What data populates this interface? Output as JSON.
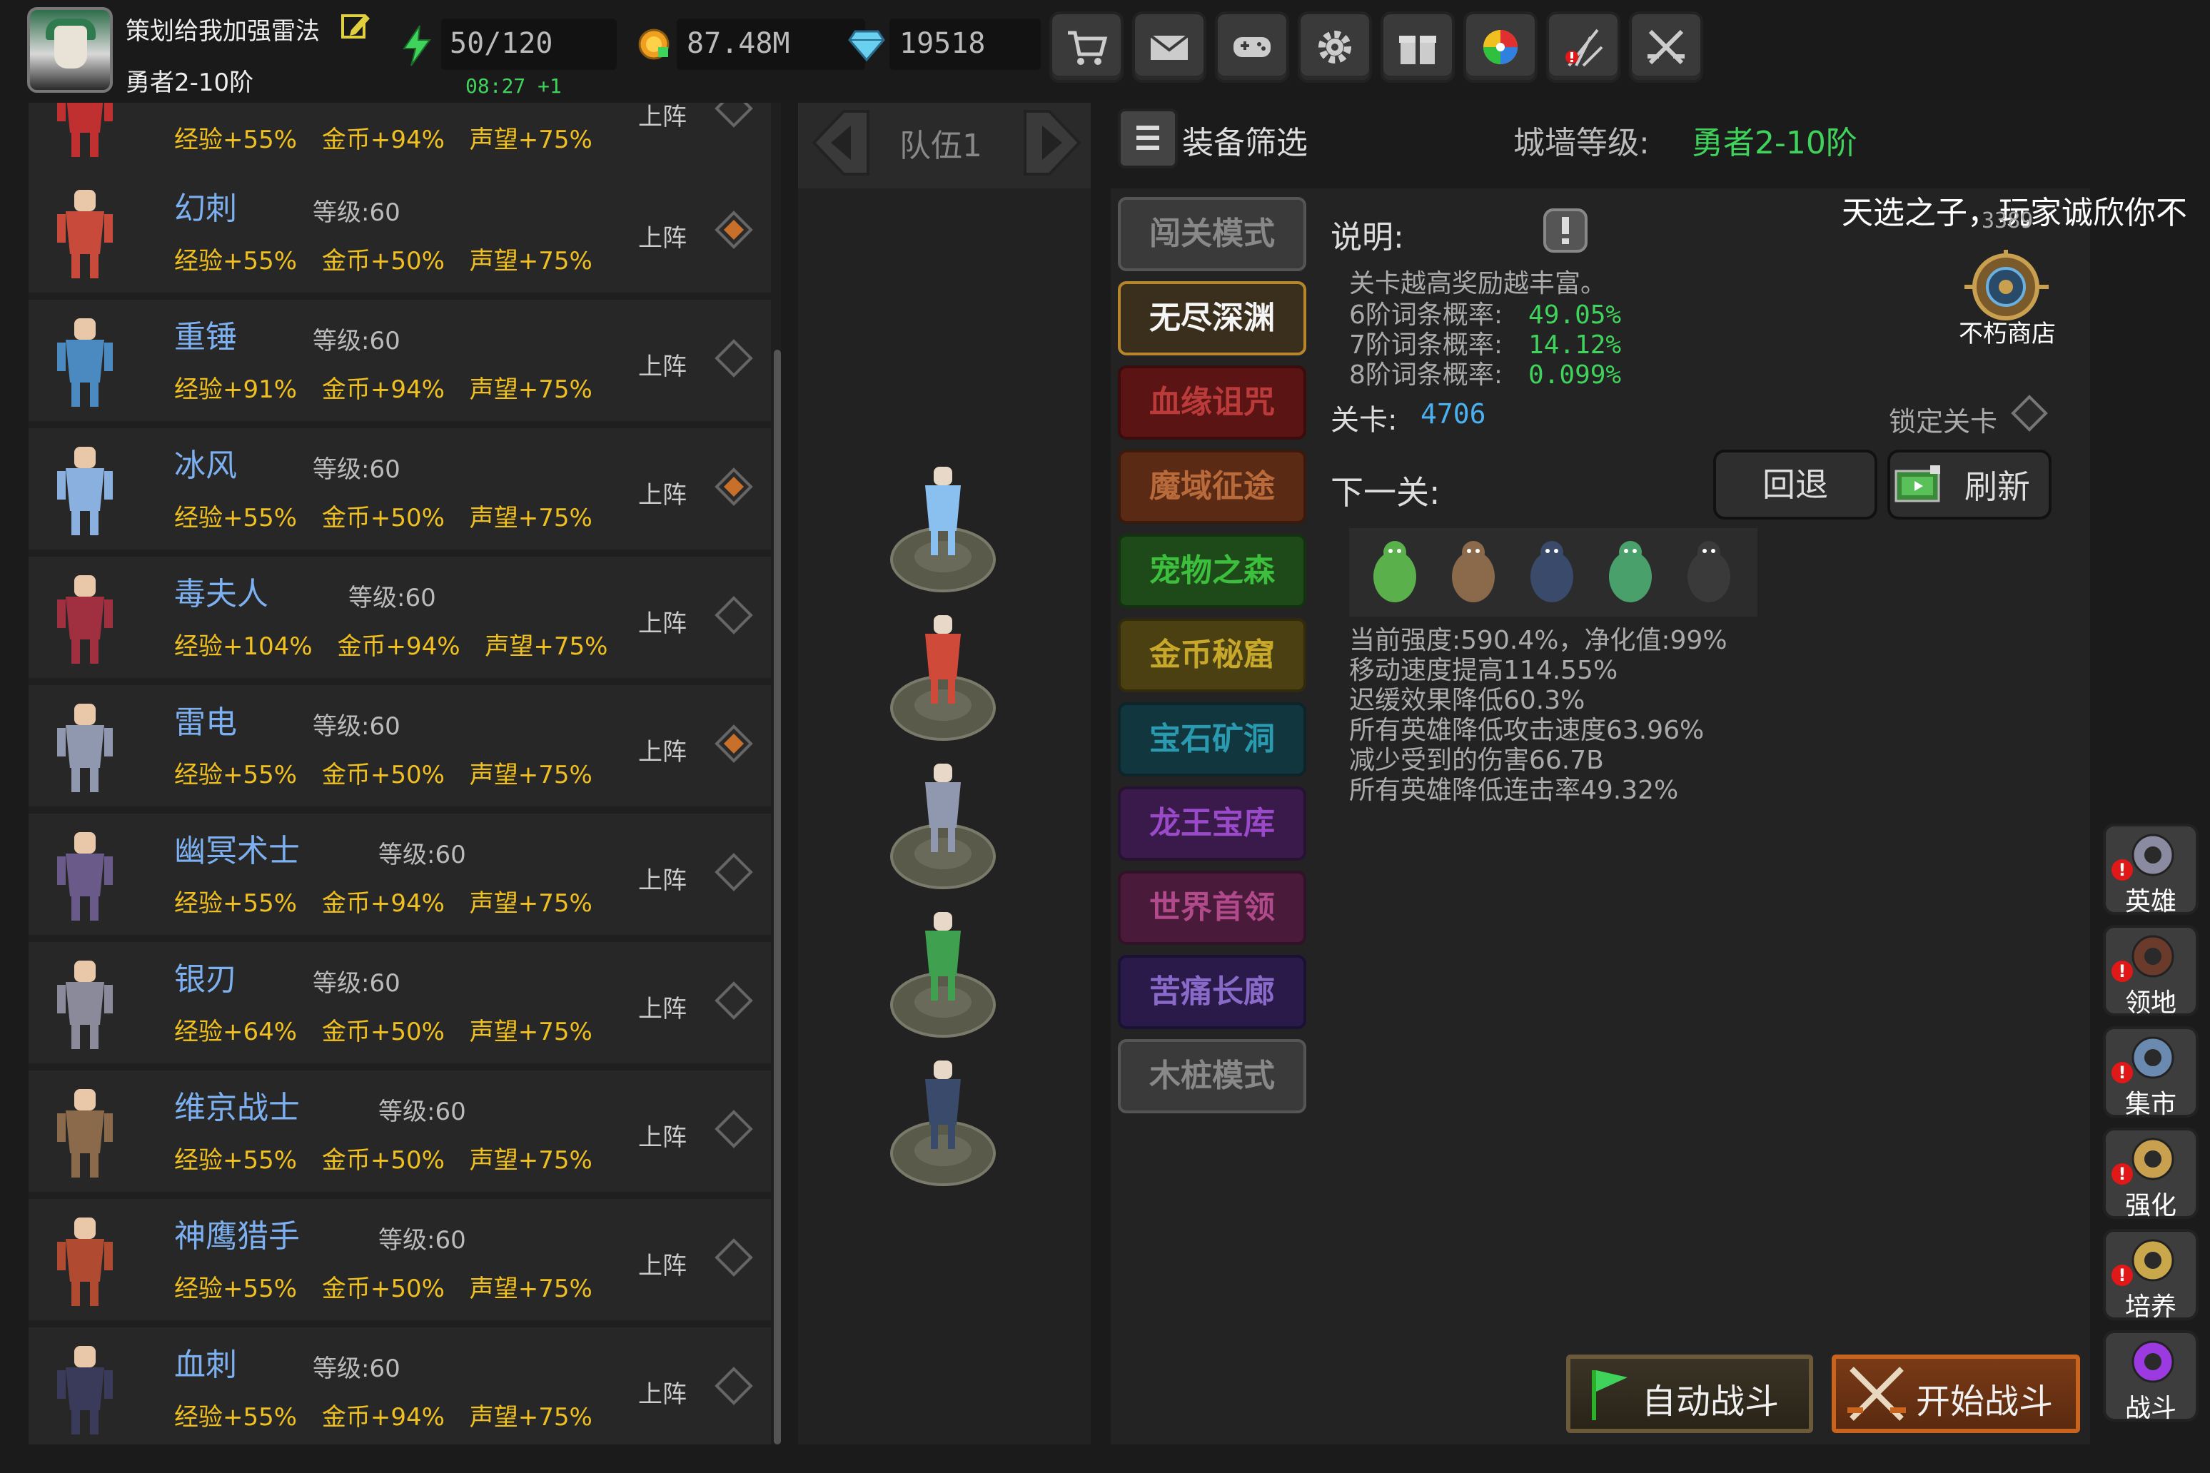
{
  "player": {
    "name": "策划给我加强雷法",
    "rank": "勇者2-10阶"
  },
  "resources": {
    "energy": "50/120",
    "energy_timer": "08:27 +1",
    "gold": "87.48M",
    "gems": "19518"
  },
  "top_buttons": [
    "shop-cart-icon",
    "mail-icon",
    "gamepad-icon",
    "settings-gear-icon",
    "gift-icon",
    "color-wheel-icon",
    "fireworks-icon",
    "crossed-swords-icon"
  ],
  "heroes": [
    {
      "name": "",
      "level": "",
      "exp": "经验+55%",
      "gold": "金币+94%",
      "fame": "声望+75%",
      "deploy": "上阵",
      "selected": false
    },
    {
      "name": "幻刺",
      "level": "等级:60",
      "exp": "经验+55%",
      "gold": "金币+50%",
      "fame": "声望+75%",
      "deploy": "上阵",
      "selected": true
    },
    {
      "name": "重锤",
      "level": "等级:60",
      "exp": "经验+91%",
      "gold": "金币+94%",
      "fame": "声望+75%",
      "deploy": "上阵",
      "selected": false
    },
    {
      "name": "冰风",
      "level": "等级:60",
      "exp": "经验+55%",
      "gold": "金币+50%",
      "fame": "声望+75%",
      "deploy": "上阵",
      "selected": true
    },
    {
      "name": "毒夫人",
      "level": "等级:60",
      "exp": "经验+104%",
      "gold": "金币+94%",
      "fame": "声望+75%",
      "deploy": "上阵",
      "selected": false
    },
    {
      "name": "雷电",
      "level": "等级:60",
      "exp": "经验+55%",
      "gold": "金币+50%",
      "fame": "声望+75%",
      "deploy": "上阵",
      "selected": true
    },
    {
      "name": "幽冥术士",
      "level": "等级:60",
      "exp": "经验+55%",
      "gold": "金币+94%",
      "fame": "声望+75%",
      "deploy": "上阵",
      "selected": false
    },
    {
      "name": "银刃",
      "level": "等级:60",
      "exp": "经验+64%",
      "gold": "金币+50%",
      "fame": "声望+75%",
      "deploy": "上阵",
      "selected": false
    },
    {
      "name": "维京战士",
      "level": "等级:60",
      "exp": "经验+55%",
      "gold": "金币+50%",
      "fame": "声望+75%",
      "deploy": "上阵",
      "selected": false
    },
    {
      "name": "神鹰猎手",
      "level": "等级:60",
      "exp": "经验+55%",
      "gold": "金币+50%",
      "fame": "声望+75%",
      "deploy": "上阵",
      "selected": false
    },
    {
      "name": "血刺",
      "level": "等级:60",
      "exp": "经验+55%",
      "gold": "金币+94%",
      "fame": "声望+75%",
      "deploy": "上阵",
      "selected": false
    }
  ],
  "team": {
    "label": "队伍1"
  },
  "filter": {
    "label": "装备筛选"
  },
  "wall": {
    "label": "城墙等级:",
    "value": "勇者2-10阶"
  },
  "marquee": {
    "text": "天选之子，玩家诚欣你不",
    "count": "3389"
  },
  "modes": [
    {
      "label": "闯关模式",
      "bg": "#3a3a3a",
      "color": "#888888",
      "border": "#555555"
    },
    {
      "label": "无尽深渊",
      "bg": "#3a2e1c",
      "color": "#f5f5f5",
      "border": "#b8862a"
    },
    {
      "label": "血缘诅咒",
      "bg": "#5a1414",
      "color": "#bb3a3a",
      "border": "#3a0c0c"
    },
    {
      "label": "魔域征途",
      "bg": "#5a2a14",
      "color": "#b86a3a",
      "border": "#3a1a0c"
    },
    {
      "label": "宠物之森",
      "bg": "#1e4a1a",
      "color": "#3cbf3c",
      "border": "#143212"
    },
    {
      "label": "金币秘窟",
      "bg": "#4a4012",
      "color": "#c8a82a",
      "border": "#322a0c"
    },
    {
      "label": "宝石矿洞",
      "bg": "#12363e",
      "color": "#2a9ab0",
      "border": "#0c242a"
    },
    {
      "label": "龙王宝库",
      "bg": "#3a1a4a",
      "color": "#9a4ac8",
      "border": "#261232"
    },
    {
      "label": "世界首领",
      "bg": "#4a1a3a",
      "color": "#b04a8a",
      "border": "#321226"
    },
    {
      "label": "苦痛长廊",
      "bg": "#2a1a4a",
      "color": "#8a6ac8",
      "border": "#1a1232"
    },
    {
      "label": "木桩模式",
      "bg": "#3a3a3a",
      "color": "#888888",
      "border": "#555555"
    }
  ],
  "description": {
    "title": "说明:",
    "text": "关卡越高奖励越丰富。",
    "probs": [
      {
        "label": "6阶词条概率:",
        "value": "49.05%"
      },
      {
        "label": "7阶词条概率:",
        "value": "14.12%"
      },
      {
        "label": "8阶词条概率:",
        "value": "0.099%"
      }
    ]
  },
  "shop": {
    "label": "不朽商店"
  },
  "stage": {
    "label": "关卡:",
    "value": "4706",
    "lock_label": "锁定关卡"
  },
  "next": {
    "label": "下一关:",
    "back": "回退",
    "refresh": "刷新",
    "enemies": [
      "medusa-icon",
      "minotaur-icon",
      "dark-beetle-icon",
      "serpent-icon",
      "wolf-icon"
    ],
    "effects": [
      "当前强度:590.4%，净化值:99%",
      "移动速度提高114.55%",
      "迟缓效果降低60.3%",
      "所有英雄降低攻击速度63.96%",
      "减少受到的伤害66.7B",
      "所有英雄降低连击率49.32%"
    ]
  },
  "actions": {
    "auto": "自动战斗",
    "start": "开始战斗"
  },
  "nav": [
    {
      "label": "英雄",
      "icon": "knight-helmet-icon",
      "alert": "!"
    },
    {
      "label": "领地",
      "icon": "castle-icon",
      "alert": "!"
    },
    {
      "label": "集市",
      "icon": "merchant-icon",
      "alert": "!"
    },
    {
      "label": "强化",
      "icon": "forge-emblem-icon",
      "alert": "!"
    },
    {
      "label": "培养",
      "icon": "trophy-icon",
      "alert": "!"
    },
    {
      "label": "战斗",
      "icon": "portal-icon",
      "alert": ""
    }
  ],
  "colors": {
    "accent_green": "#3fd35b",
    "hero_name_blue": "#7db0f0",
    "stat_gold": "#f0c020",
    "stage_blue": "#4ab0f0",
    "alert_red": "#e01818"
  }
}
